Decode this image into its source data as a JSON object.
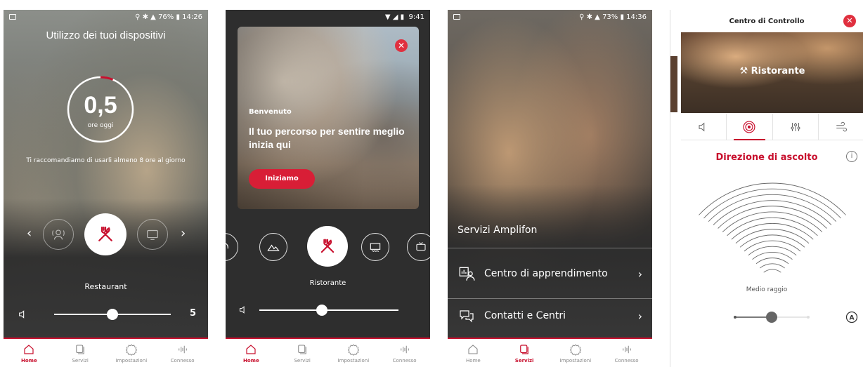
{
  "screen1": {
    "status": {
      "signal": "76%",
      "time": "14:26"
    },
    "title": "Utilizzo dei tuoi dispositivi",
    "usage_value": "0,5",
    "usage_unit": "ore oggi",
    "usage_fraction": 0.0625,
    "tip": "Ti raccomandiamo di usarli almeno 8 ore al giorno",
    "program_label": "Restaurant",
    "volume_value": "5",
    "volume_level": 0.5
  },
  "screen2": {
    "status": {
      "time": "9:41"
    },
    "card": {
      "welcome": "Benvenuto",
      "headline": "Il tuo percorso per sentire meglio inizia qui",
      "button": "Iniziamo"
    },
    "program_label": "Ristorante",
    "volume_level": 0.45
  },
  "screen3": {
    "status": {
      "signal": "73%",
      "time": "14:36"
    },
    "section_title": "Servizi Amplifon",
    "items": [
      {
        "label": "Centro di apprendimento"
      },
      {
        "label": "Contatti e Centri"
      }
    ]
  },
  "screen4": {
    "header_title": "Centro di Controllo",
    "image_label": "Ristorante",
    "section_title": "Direzione di ascolto",
    "range_label": "Medio raggio",
    "range_level": 0.5
  },
  "tabbar": {
    "home": "Home",
    "servizi": "Servizi",
    "impostazioni": "Impostazioni",
    "connesso": "Connesso"
  },
  "colors": {
    "accent": "#c8102e",
    "button_red": "#d81e36"
  }
}
